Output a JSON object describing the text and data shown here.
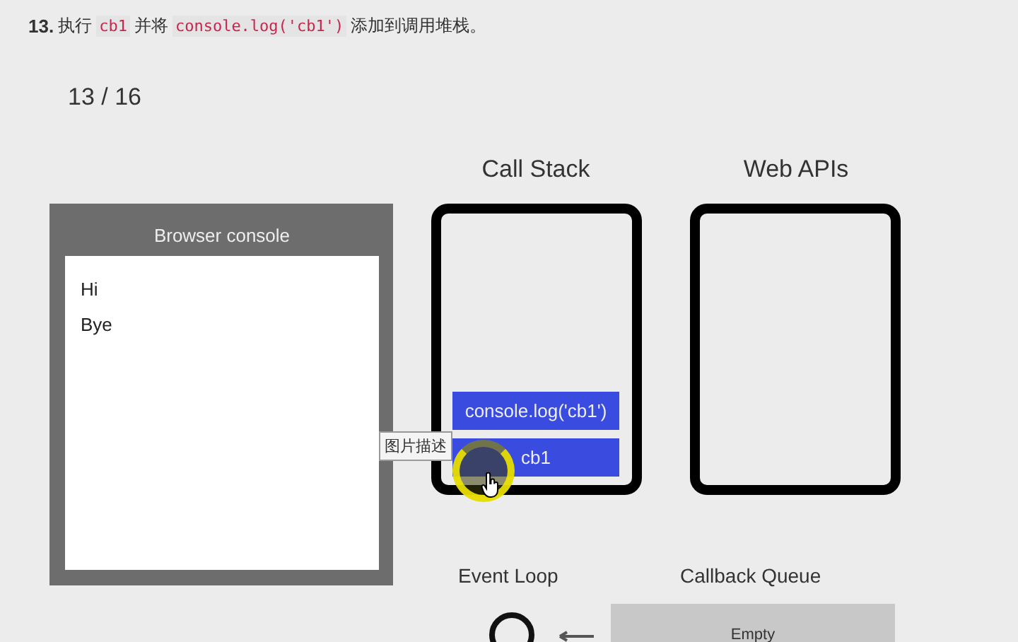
{
  "heading": [
    {
      "kind": "number",
      "text": "13."
    },
    {
      "kind": "text",
      "text": "执行"
    },
    {
      "kind": "code",
      "text": "cb1"
    },
    {
      "kind": "text",
      "text": "并将"
    },
    {
      "kind": "code",
      "text": "console.log('cb1')"
    },
    {
      "kind": "text",
      "text": "添加到调用堆栈。"
    }
  ],
  "counter": "13 / 16",
  "browser_console": {
    "title": "Browser console",
    "lines": [
      "Hi",
      "Bye"
    ]
  },
  "call_stack": {
    "title": "Call Stack",
    "frames": [
      "console.log('cb1')",
      "cb1"
    ]
  },
  "web_apis": {
    "title": "Web APIs"
  },
  "event_loop": {
    "title": "Event Loop"
  },
  "callback_queue": {
    "title": "Callback Queue",
    "text": "Empty"
  },
  "tooltip": "图片描述"
}
